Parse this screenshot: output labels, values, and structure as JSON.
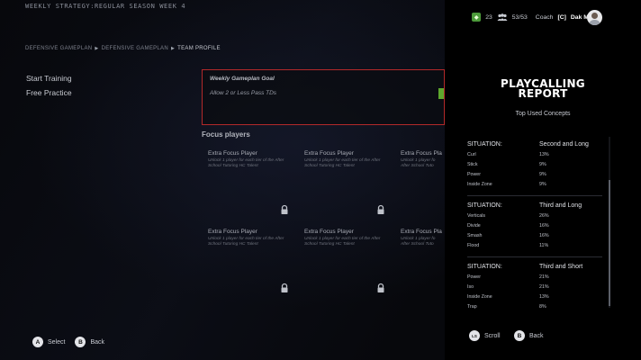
{
  "header": {
    "title": "WEEKLY STRATEGY:REGULAR SEASON WEEK 4",
    "breadcrumb": [
      "DEFENSIVE GAMEPLAN",
      "DEFENSIVE GAMEPLAN",
      "TEAM PROFILE"
    ],
    "status": {
      "level": "23",
      "players_icon": "team-icon",
      "roster": "53/53",
      "coach_label": "Coach",
      "captain": "[C]",
      "coach_name": "Dak Miller",
      "level_icon": "level-badge-icon"
    }
  },
  "menu": {
    "items": [
      {
        "label": "Start Training"
      },
      {
        "label": "Free Practice"
      }
    ]
  },
  "goal": {
    "title": "Weekly Gameplan Goal",
    "text": "Allow 2 or Less Pass TDs",
    "accent": "#b3292a",
    "progress_color": "#5ea82d"
  },
  "focus": {
    "title": "Focus players",
    "cards": [
      {
        "title": "Extra Focus Player",
        "desc": "Unlock 1 player for each tier of the After School Tutoring HC Talent"
      },
      {
        "title": "Extra Focus Player",
        "desc": "Unlock 1 player for each tier of the After School Tutoring HC Talent"
      },
      {
        "title": "Extra Focus Pla",
        "desc": "Unlock 1 player fo After School Tuto"
      },
      {
        "title": "Extra Focus Player",
        "desc": "Unlock 1 player for each tier of the After School Tutoring HC Talent"
      },
      {
        "title": "Extra Focus Player",
        "desc": "Unlock 1 player for each tier of the After School Tutoring HC Talent"
      },
      {
        "title": "Extra Focus Pla",
        "desc": "Unlock 1 player fo After School Tuto"
      }
    ],
    "lock_icon": "lock-icon"
  },
  "report": {
    "title_line1": "PLAYCALLING",
    "title_line2": "REPORT",
    "subtitle": "Top Used Concepts",
    "situations": [
      {
        "label": "SITUATION:",
        "name": "Second and Long",
        "rows": [
          {
            "concept": "Curl",
            "pct": "13%"
          },
          {
            "concept": "Stick",
            "pct": "9%"
          },
          {
            "concept": "Power",
            "pct": "9%"
          },
          {
            "concept": "Inside Zone",
            "pct": "9%"
          }
        ]
      },
      {
        "label": "SITUATION:",
        "name": "Third and Long",
        "rows": [
          {
            "concept": "Verticals",
            "pct": "26%"
          },
          {
            "concept": "Divide",
            "pct": "16%"
          },
          {
            "concept": "Smash",
            "pct": "16%"
          },
          {
            "concept": "Flood",
            "pct": "11%"
          }
        ]
      },
      {
        "label": "SITUATION:",
        "name": "Third and Short",
        "rows": [
          {
            "concept": "Power",
            "pct": "21%"
          },
          {
            "concept": "Iso",
            "pct": "21%"
          },
          {
            "concept": "Inside Zone",
            "pct": "13%"
          },
          {
            "concept": "Trap",
            "pct": "8%"
          }
        ]
      }
    ]
  },
  "hints": {
    "select_btn": "A",
    "select_label": "Select",
    "back_btn": "B",
    "back_label": "Back",
    "scroll_btn": "LS",
    "scroll_label": "Scroll",
    "panel_back_btn": "B",
    "panel_back_label": "Back"
  }
}
